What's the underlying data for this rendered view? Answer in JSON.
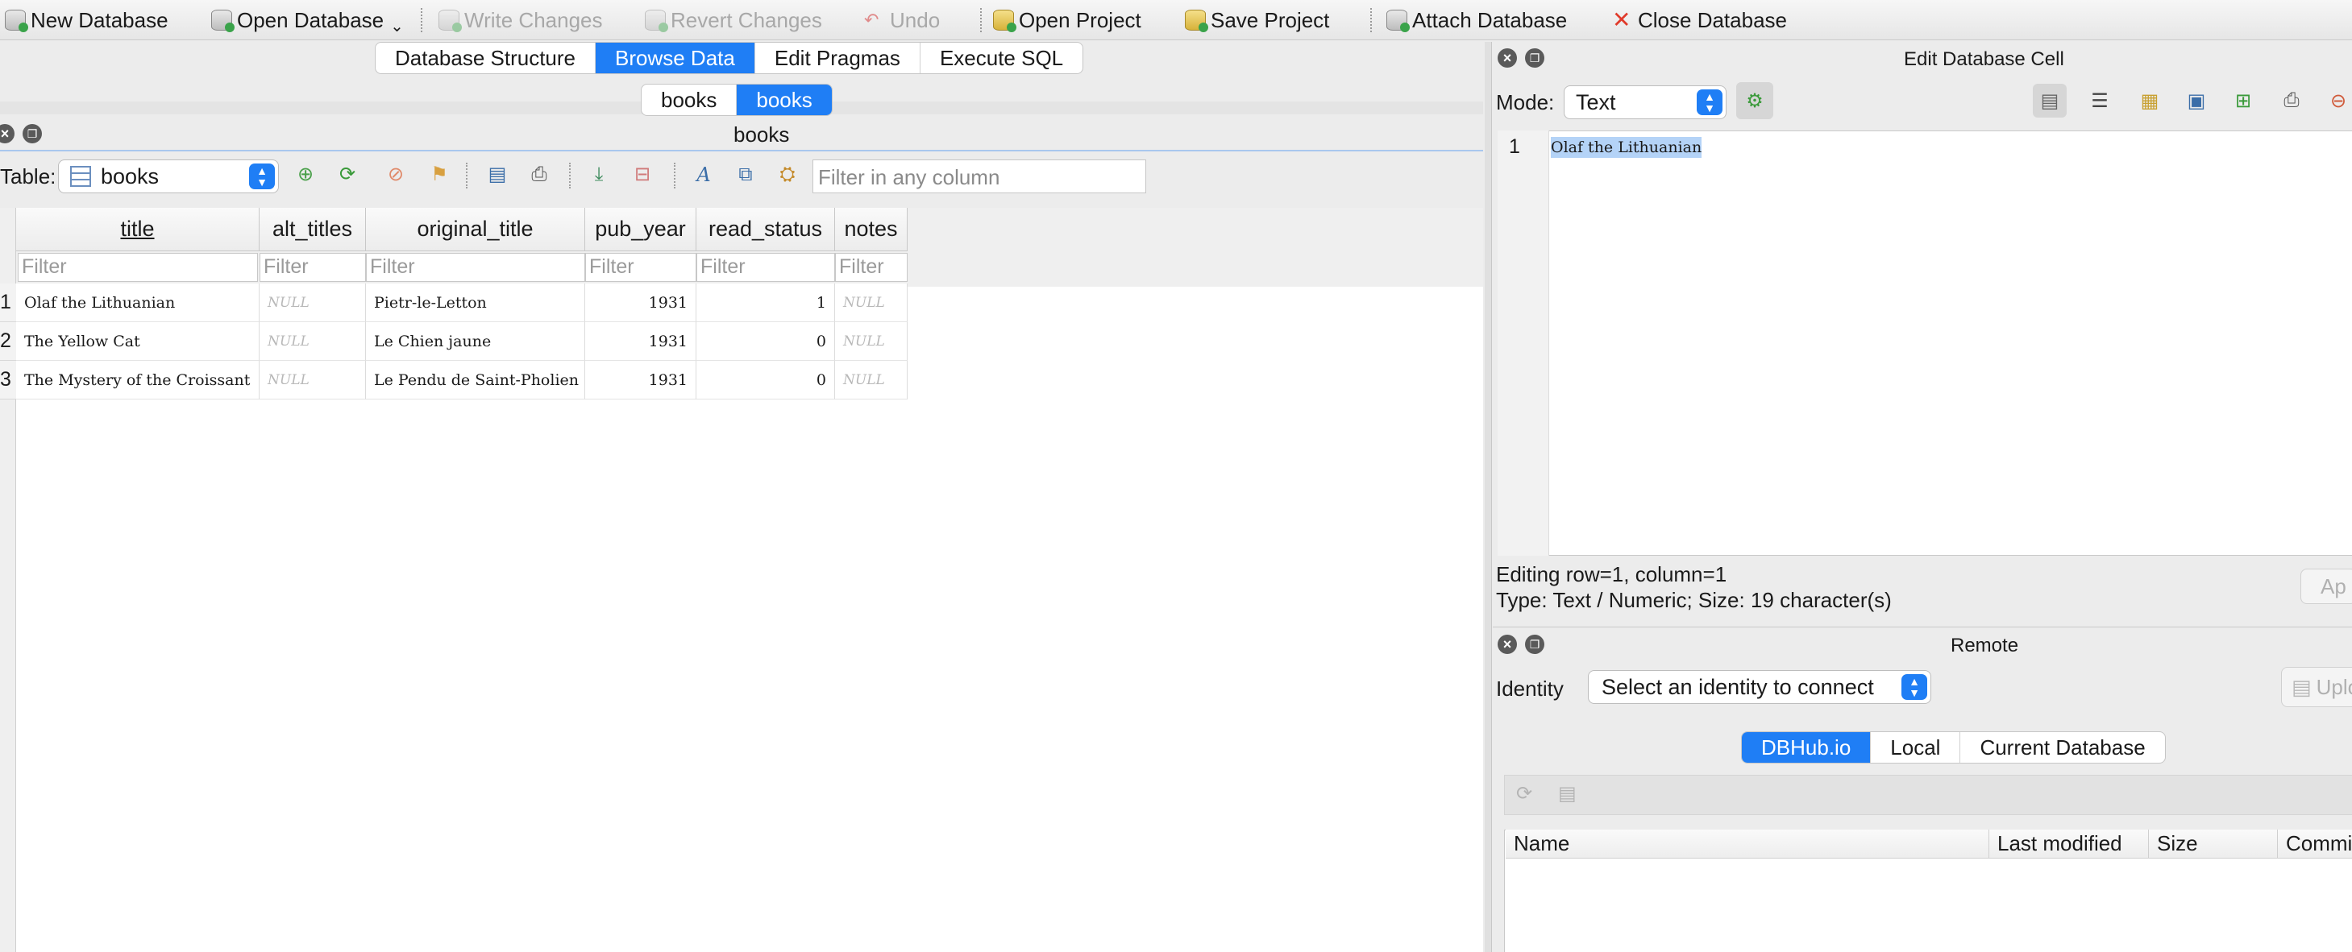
{
  "toolbar": {
    "new_database": "New Database",
    "open_database": "Open Database",
    "write_changes": "Write Changes",
    "revert_changes": "Revert Changes",
    "undo": "Undo",
    "open_project": "Open Project",
    "save_project": "Save Project",
    "attach_database": "Attach Database",
    "close_database": "Close Database"
  },
  "main_tabs": [
    "Database Structure",
    "Browse Data",
    "Edit Pragmas",
    "Execute SQL"
  ],
  "browse_tabs": [
    "books",
    "books"
  ],
  "browse_panel": {
    "title": "books",
    "table_label": "Table:",
    "table_selected": "books",
    "filter_any_placeholder": "Filter in any column"
  },
  "grid": {
    "columns": [
      "title",
      "alt_titles",
      "original_title",
      "pub_year",
      "read_status",
      "notes"
    ],
    "filter_placeholder": "Filter",
    "rows": [
      {
        "num": "1",
        "title": "Olaf the Lithuanian",
        "alt_titles": "NULL",
        "original_title": "Pietr-le-Letton",
        "pub_year": "1931",
        "read_status": "1",
        "notes": "NULL"
      },
      {
        "num": "2",
        "title": "The Yellow Cat",
        "alt_titles": "NULL",
        "original_title": "Le Chien jaune",
        "pub_year": "1931",
        "read_status": "0",
        "notes": "NULL"
      },
      {
        "num": "3",
        "title": "The Mystery of the Croissant",
        "alt_titles": "NULL",
        "original_title": "Le Pendu de Saint-Pholien",
        "pub_year": "1931",
        "read_status": "0",
        "notes": "NULL"
      }
    ]
  },
  "edit_cell": {
    "title": "Edit Database Cell",
    "mode_label": "Mode:",
    "mode_value": "Text",
    "line_number": "1",
    "content": "Olaf the Lithuanian",
    "editing_info": "Editing row=1, column=1",
    "type_info": "Type: Text / Numeric; Size: 19 character(s)",
    "apply_label": "Ap"
  },
  "remote": {
    "title": "Remote",
    "identity_label": "Identity",
    "identity_value": "Select an identity to connect",
    "upload_label": "Uplo",
    "tabs": [
      "DBHub.io",
      "Local",
      "Current Database"
    ],
    "columns": [
      "Name",
      "Last modified",
      "Size",
      "Commi"
    ]
  },
  "colors": {
    "accent": "#1f7ef5",
    "selection": "#b4d3f7",
    "close_red": "#e03a2a"
  }
}
